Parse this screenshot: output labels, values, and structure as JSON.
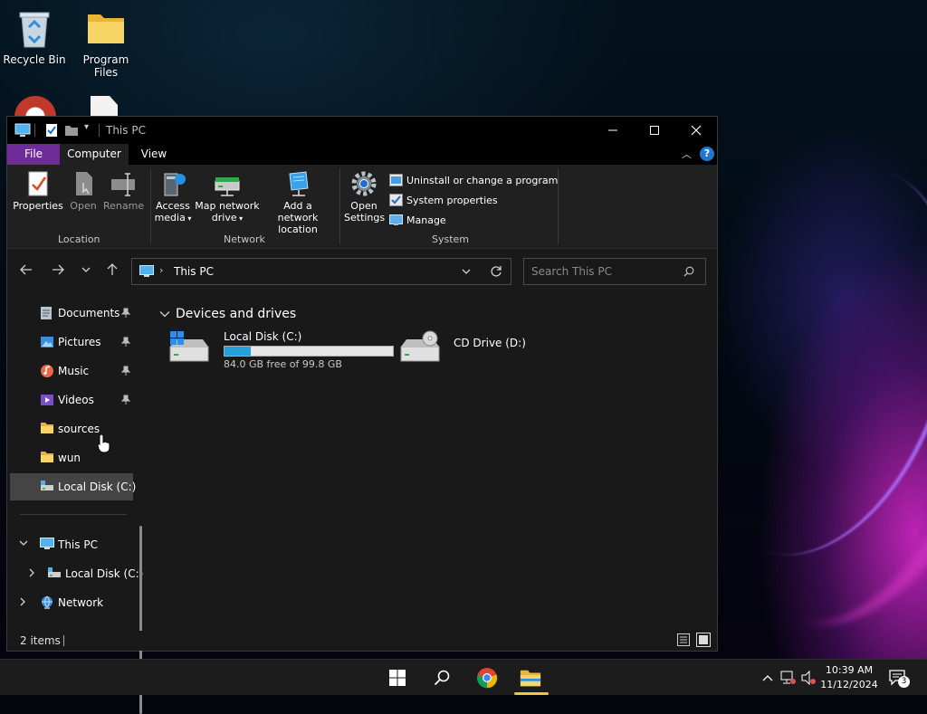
{
  "desktop": {
    "icons": [
      {
        "label": "Recycle Bin",
        "icon": "recycle-bin-icon"
      },
      {
        "label": "Program Files",
        "icon": "folder-icon"
      }
    ]
  },
  "window": {
    "title": "This PC",
    "tabs": [
      {
        "label": "File"
      },
      {
        "label": "Computer"
      },
      {
        "label": "View"
      }
    ],
    "ribbon": {
      "location": {
        "label": "Location",
        "properties": "Properties",
        "open": "Open",
        "rename": "Rename"
      },
      "network": {
        "label": "Network",
        "access_media_1": "Access",
        "access_media_2": "media",
        "map_drive_1": "Map network",
        "map_drive_2": "drive",
        "add_location_1": "Add a network",
        "add_location_2": "location"
      },
      "system": {
        "label": "System",
        "open_settings_1": "Open",
        "open_settings_2": "Settings",
        "uninstall": "Uninstall or change a program",
        "system_properties": "System properties",
        "manage": "Manage"
      }
    },
    "address": {
      "path": "This PC"
    },
    "search": {
      "placeholder": "Search This PC"
    },
    "nav_pane": {
      "items": [
        {
          "label": "Documents",
          "icon": "documents-icon",
          "pinned": true
        },
        {
          "label": "Pictures",
          "icon": "pictures-icon",
          "pinned": true
        },
        {
          "label": "Music",
          "icon": "music-icon",
          "pinned": true
        },
        {
          "label": "Videos",
          "icon": "videos-icon",
          "pinned": true
        },
        {
          "label": "sources",
          "icon": "folder-icon",
          "pinned": false
        },
        {
          "label": "wun",
          "icon": "folder-icon",
          "pinned": false
        },
        {
          "label": "Local Disk (C:)",
          "icon": "local-disk-icon",
          "pinned": false,
          "selected": true
        }
      ],
      "tree": [
        {
          "label": "This PC",
          "icon": "this-pc-icon",
          "expanded": true
        },
        {
          "label": "Local Disk (C:)",
          "icon": "local-disk-icon",
          "expanded": false
        },
        {
          "label": "Network",
          "icon": "network-icon",
          "expanded": false
        }
      ]
    },
    "content": {
      "group_header": "Devices and drives",
      "drives": [
        {
          "name": "Local Disk (C:)",
          "free_text": "84.0 GB free of 99.8 GB",
          "used_percent": 15.8
        },
        {
          "name": "CD Drive (D:)"
        }
      ]
    },
    "status": {
      "items_count": "2 items"
    }
  },
  "taskbar": {
    "time": "10:39 AM",
    "date": "11/12/2024",
    "notification_count": "3"
  },
  "colors": {
    "file_tab": "#6e2c98",
    "drive_bar": "#26a0da",
    "window_bg": "#191919"
  }
}
